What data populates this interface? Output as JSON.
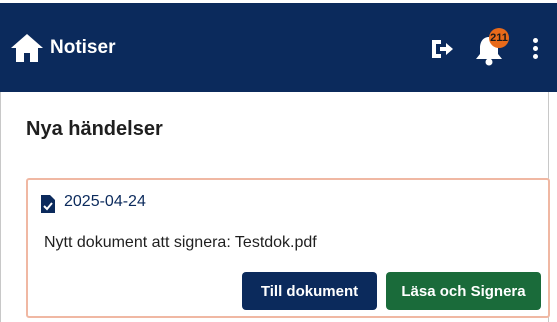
{
  "header": {
    "title": "Notiser",
    "home_icon": "home-icon",
    "logout_icon": "logout-icon",
    "bell_icon": "bell-icon",
    "notification_count": "211",
    "menu_icon": "kebab-menu-icon",
    "bg_color": "#0b2a5c",
    "badge_color": "#e86a1a"
  },
  "main": {
    "section_title": "Nya händelser",
    "card": {
      "icon": "document-check-icon",
      "date": "2025-04-24",
      "message": "Nytt dokument att signera: Testdok.pdf",
      "border_color": "#f0b8a3",
      "primary_button": "Till dokument",
      "primary_color": "#0b2a5c",
      "secondary_button": "Läsa och Signera",
      "secondary_color": "#1a6b3a"
    }
  }
}
